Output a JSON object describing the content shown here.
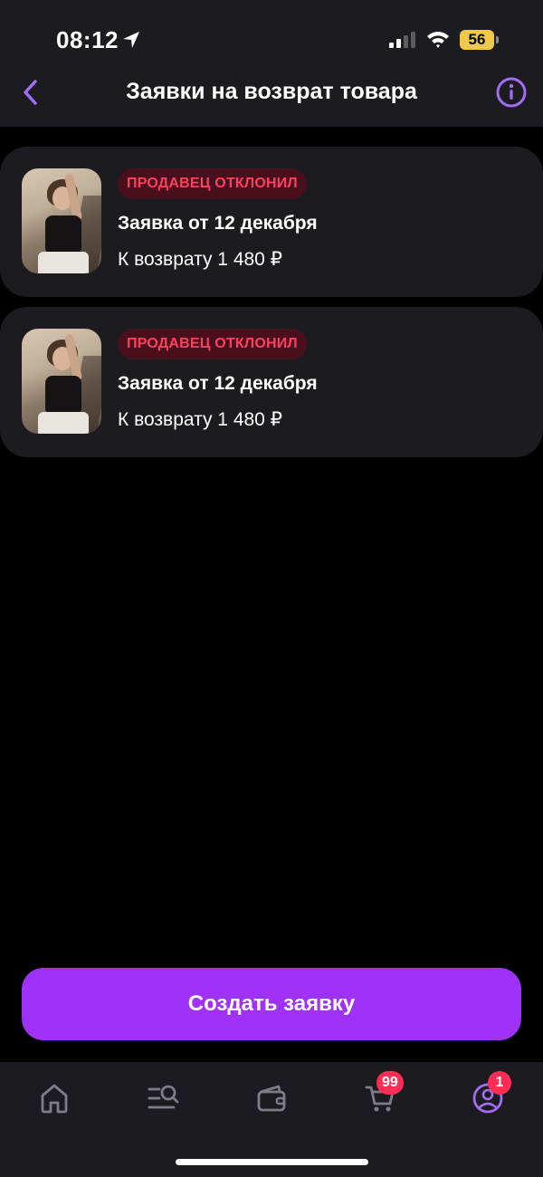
{
  "status_bar": {
    "time": "08:12",
    "battery_level": "56",
    "icons": [
      "location-arrow-icon",
      "cellular-signal-icon",
      "wifi-icon",
      "battery-icon"
    ]
  },
  "header": {
    "title": "Заявки на возврат товара",
    "back_icon": "chevron-left-icon",
    "info_icon": "info-icon",
    "accent_color": "#a36cf5"
  },
  "requests": [
    {
      "status": "ПРОДАВЕЦ ОТКЛОНИЛ",
      "title": "Заявка от 12 декабря",
      "amount": "К возврату 1 480 ₽"
    },
    {
      "status": "ПРОДАВЕЦ ОТКЛОНИЛ",
      "title": "Заявка от 12 декабря",
      "amount": "К возврату 1 480 ₽"
    }
  ],
  "status_colors": {
    "rejected_text": "#ff3f5f",
    "rejected_bg": "#4a0f1d"
  },
  "actions": {
    "create_label": "Создать заявку",
    "create_color": "#a031f8"
  },
  "tab_bar": {
    "tabs": [
      {
        "icon": "home-icon"
      },
      {
        "icon": "catalog-search-icon"
      },
      {
        "icon": "wallet-icon"
      },
      {
        "icon": "cart-icon",
        "badge": "99"
      },
      {
        "icon": "profile-icon",
        "badge": "1",
        "active": true
      }
    ]
  }
}
